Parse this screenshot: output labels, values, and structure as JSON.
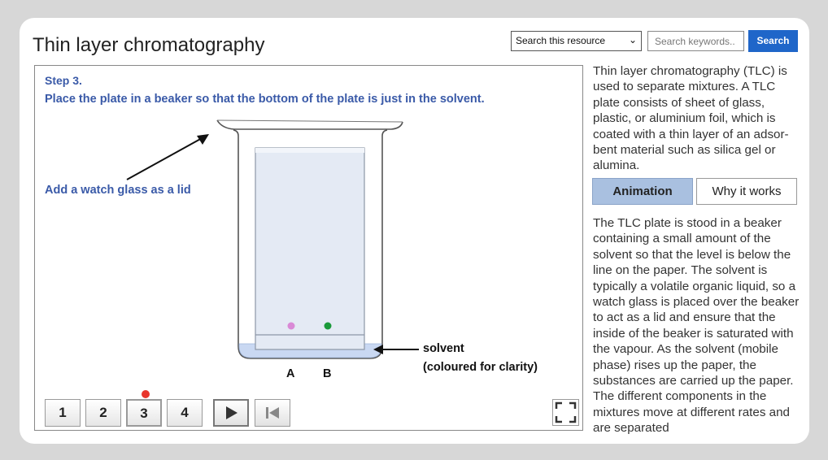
{
  "page": {
    "title": "Thin layer chromatography"
  },
  "search": {
    "scope_selected": "Search this resource",
    "keyword_placeholder": "Search keywords..",
    "button_label": "Search"
  },
  "simulation": {
    "step_title": "Step 3.",
    "instruction": "Place the plate in a beaker so that the bottom of the plate is just in the solvent.",
    "watch_glass_label": "Add a watch glass as a lid",
    "solvent_label": "solvent",
    "solvent_note": "(coloured for clarity)",
    "spot_labels": [
      "A",
      "B"
    ],
    "steps": [
      "1",
      "2",
      "3",
      "4"
    ],
    "current_step": "3",
    "spot_colors": {
      "A": "#d98ad6",
      "B": "#1a9a3a"
    },
    "solvent_color": "#c9d8f2"
  },
  "sidebar": {
    "intro": "Thin layer chromatography (TLC) is used to separate mixtures. A TLC plate consists of sheet of glass, plastic, or aluminium foil, which is coated with a thin layer of an adsor-bent material such as silica gel or alumina.",
    "tabs": [
      {
        "label": "Animation",
        "active": true
      },
      {
        "label": "Why it works",
        "active": false
      }
    ],
    "body": "The TLC plate is stood in a beaker containing a small amount of the solvent so that the level is below the line on the paper. The solvent is typically a volatile organic liquid, so a watch glass is placed over the beaker to act as a lid and ensure that the inside of the beaker is saturated with the vapour. As the solvent (mobile phase) rises up the paper, the substances are carried up the paper. The different components in the mixtures move at different rates and are separated"
  },
  "colors": {
    "accent": "#1f66c9",
    "heading_blue": "#3a5aa8",
    "active_tab": "#a9c0e0",
    "step_dot": "#e8352b"
  }
}
